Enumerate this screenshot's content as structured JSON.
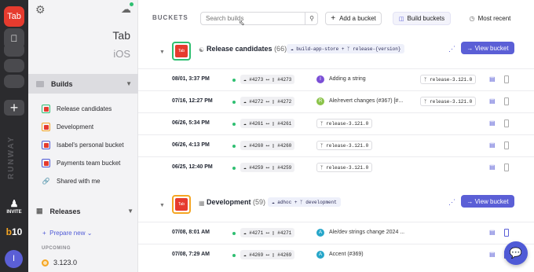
{
  "rail": {
    "app_tab_label": "Tab",
    "invite_label": "INVITE",
    "runway_label": "RUNWAY",
    "b10_label": "b10",
    "avatar_initial": "I"
  },
  "sidebar": {
    "app_title": "Tab",
    "platform": "iOS",
    "builds_header": "Builds",
    "buckets": [
      {
        "label": "Release candidates",
        "color": "#2fbf71"
      },
      {
        "label": "Development",
        "color": "#f5a623"
      },
      {
        "label": "Isabel's personal bucket",
        "color": "#4f5ad6"
      },
      {
        "label": "Payments team bucket",
        "color": "#4f5ad6"
      }
    ],
    "shared_label": "Shared with me",
    "releases_header": "Releases",
    "prepare_new": "Prepare new",
    "upcoming_label": "UPCOMING",
    "upcoming_version": "3.123.0"
  },
  "toolbar": {
    "section_label": "BUCKETS",
    "search_placeholder": "Search builds",
    "add_bucket": "Add a bucket",
    "build_buckets": "Build buckets",
    "most_recent": "Most recent"
  },
  "buckets": [
    {
      "name": "Release candidates",
      "count": "(66)",
      "source": "build-app-store",
      "branch": "release-{version}",
      "view_label": "View bucket",
      "accent": "#2fbf71",
      "rows": [
        {
          "date": "08/01, 3:37 PM",
          "from": "#4273",
          "to": "#4273",
          "avatar": "I",
          "avatar_color": "#7b4fd6",
          "message": "Adding a string",
          "branch": "release-3.121.0"
        },
        {
          "date": "07/16, 12:27 PM",
          "from": "#4272",
          "to": "#4272",
          "avatar": "R",
          "avatar_color": "#8bc34a",
          "message": "Ale/revert changes (#367) [#...",
          "branch": "release-3.121.0"
        },
        {
          "date": "06/26, 5:34 PM",
          "from": "#4261",
          "to": "#4261",
          "avatar": "",
          "avatar_color": "",
          "message": "",
          "branch": "release-3.121.0"
        },
        {
          "date": "06/26, 4:13 PM",
          "from": "#4260",
          "to": "#4260",
          "avatar": "",
          "avatar_color": "",
          "message": "",
          "branch": "release-3.121.0"
        },
        {
          "date": "06/25, 12:40 PM",
          "from": "#4259",
          "to": "#4259",
          "avatar": "",
          "avatar_color": "",
          "message": "",
          "branch": "release-3.121.0"
        }
      ]
    },
    {
      "name": "Development",
      "count": "(59)",
      "source": "adhoc",
      "branch": "development",
      "view_label": "View bucket",
      "accent": "#f5a623",
      "rows": [
        {
          "date": "07/08, 8:01 AM",
          "from": "#4271",
          "to": "#4271",
          "avatar": "A",
          "avatar_color": "#26a6c9",
          "message": "Ale/dev strings change 2024 ...",
          "branch": ""
        },
        {
          "date": "07/08, 7:29 AM",
          "from": "#4269",
          "to": "#4269",
          "avatar": "A",
          "avatar_color": "#26a6c9",
          "message": "Accent (#369)",
          "branch": ""
        }
      ]
    }
  ]
}
